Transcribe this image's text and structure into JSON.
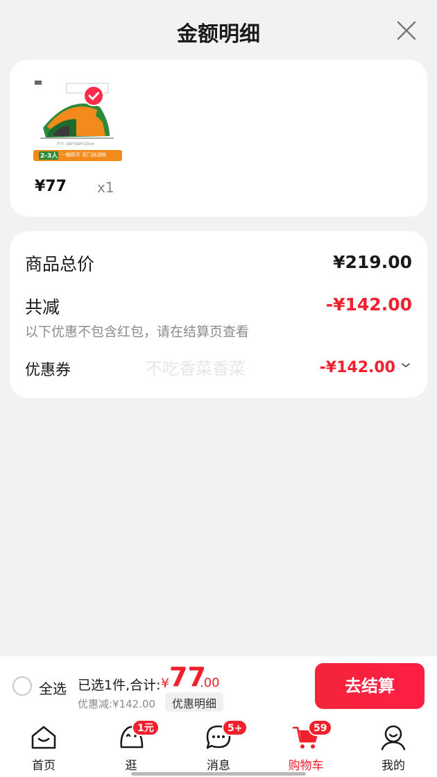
{
  "header": {
    "title": "金额明细"
  },
  "product": {
    "price": "¥77",
    "quantity": "x1",
    "image_tag": "2-3人",
    "image_caption": "一触即开 双门自动帐"
  },
  "summary": {
    "total_label": "商品总价",
    "total_value": "¥219.00",
    "reduce_label": "共减",
    "reduce_value": "-¥142.00",
    "note": "以下优惠不包含红包，请在结算页查看",
    "coupon_label": "优惠券",
    "coupon_value": "-¥142.00",
    "watermark": "不吃香菜香菜"
  },
  "checkout": {
    "select_all": "全选",
    "selected_text": "已选1件,合计:",
    "currency": "¥",
    "total_int": "77",
    "total_dec": ".00",
    "discount_text": "优惠减:¥142.00",
    "detail_chip": "优惠明细",
    "pay_label": "去结算"
  },
  "tabbar": {
    "items": [
      {
        "label": "首页",
        "icon": "home-icon"
      },
      {
        "label": "逛",
        "icon": "browse-icon",
        "badge": "1元"
      },
      {
        "label": "消息",
        "icon": "message-icon",
        "badge": "5+"
      },
      {
        "label": "购物车",
        "icon": "cart-icon",
        "badge": "59",
        "active": true
      },
      {
        "label": "我的",
        "icon": "profile-icon"
      }
    ]
  },
  "colors": {
    "accent": "#f0202c",
    "background": "#f2f2f2",
    "tent_orange": "#f28a1c",
    "tent_green": "#2d8a3a"
  }
}
